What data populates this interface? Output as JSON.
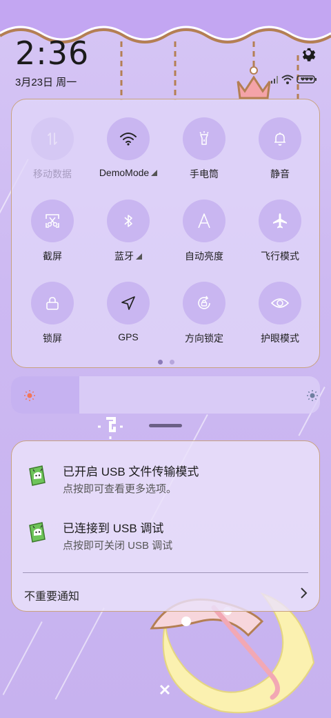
{
  "status_bar": {
    "time": "2:36",
    "date": "3月23日 周一"
  },
  "quick_settings": {
    "tiles": [
      {
        "label": "移动数据",
        "icon": "mobile-data-icon",
        "enabled": false,
        "has_more": false
      },
      {
        "label": "DemoMode",
        "icon": "wifi-icon",
        "enabled": true,
        "has_more": true
      },
      {
        "label": "手电筒",
        "icon": "flashlight-icon",
        "enabled": true,
        "has_more": false
      },
      {
        "label": "静音",
        "icon": "bell-icon",
        "enabled": true,
        "has_more": false
      },
      {
        "label": "截屏",
        "icon": "screenshot-icon",
        "enabled": true,
        "has_more": false
      },
      {
        "label": "蓝牙",
        "icon": "bluetooth-icon",
        "enabled": true,
        "has_more": true
      },
      {
        "label": "自动亮度",
        "icon": "auto-brightness-icon",
        "enabled": true,
        "has_more": false
      },
      {
        "label": "飞行模式",
        "icon": "airplane-icon",
        "enabled": true,
        "has_more": false
      },
      {
        "label": "锁屏",
        "icon": "lock-icon",
        "enabled": true,
        "has_more": false
      },
      {
        "label": "GPS",
        "icon": "location-icon",
        "enabled": true,
        "has_more": false
      },
      {
        "label": "方向锁定",
        "icon": "rotation-lock-icon",
        "enabled": true,
        "has_more": false
      },
      {
        "label": "护眼模式",
        "icon": "eye-icon",
        "enabled": true,
        "has_more": false
      }
    ],
    "page_count": 2,
    "active_page": 1
  },
  "brightness": {
    "level": 0.22
  },
  "notifications": [
    {
      "title": "已开启 USB 文件传输模式",
      "body": "点按即可查看更多选项。",
      "icon": "android-debug-icon"
    },
    {
      "title": "已连接到 USB 调试",
      "body": "点按即可关闭 USB 调试",
      "icon": "android-debug-icon"
    }
  ],
  "unimportant_notifications": {
    "label": "不重要通知"
  },
  "colors": {
    "background": "#cdb9f2",
    "tile_bg": "#c6b2f0",
    "panel_border": "#c9a27e",
    "icon": "#ffffff"
  }
}
